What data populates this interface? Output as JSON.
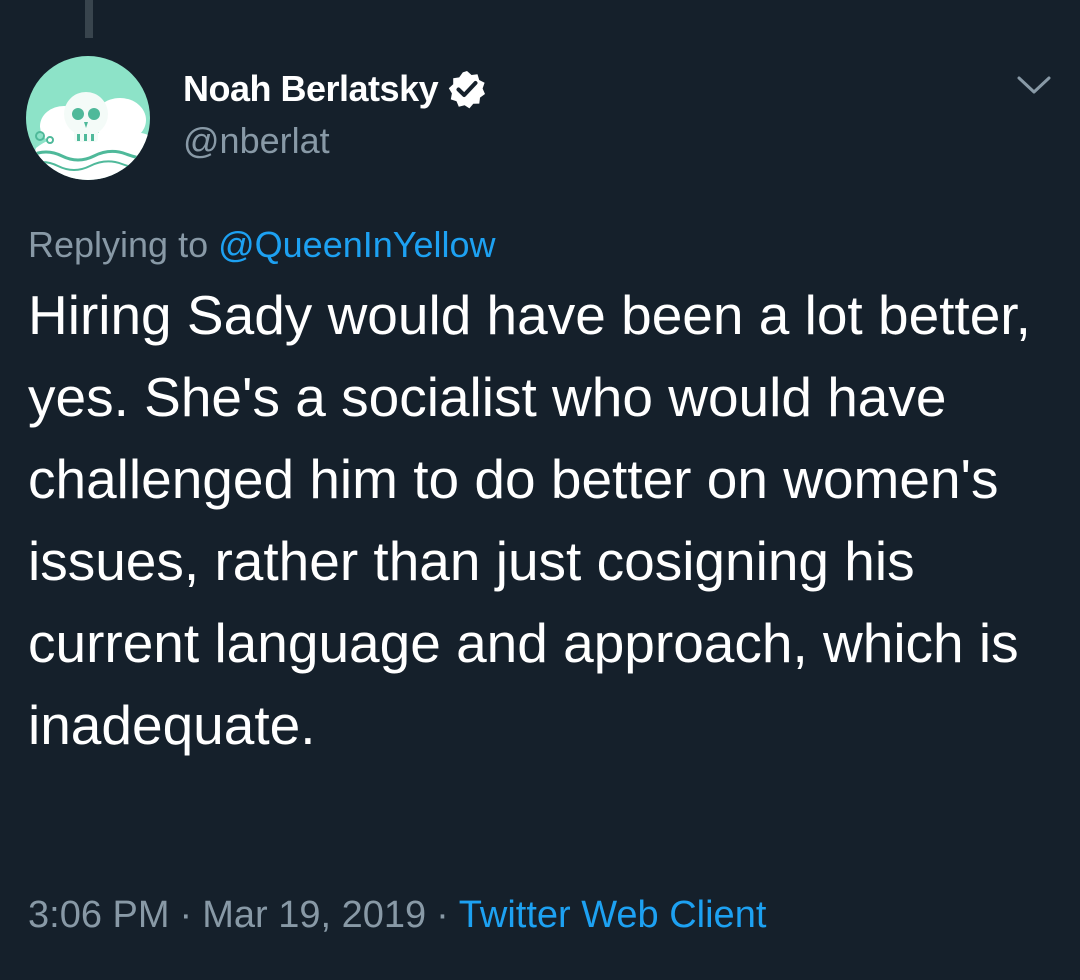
{
  "tweet": {
    "author": {
      "display_name": "Noah Berlatsky",
      "handle": "@nberlat",
      "verified": true,
      "avatar_icon": "skull-avatar",
      "avatar_bg": "#8de3c8"
    },
    "menu_icon": "chevron-down-icon",
    "replying": {
      "prefix": "Replying to ",
      "mention": "@QueenInYellow"
    },
    "text": "Hiring Sady would have been a lot better, yes. She's a socialist who would have challenged him to do better on women's issues, rather than just cosigning his current language and approach, which is inadequate.",
    "time": "3:06 PM",
    "separator": "·",
    "date": "Mar 19, 2019",
    "source": "Twitter Web Client"
  },
  "colors": {
    "background": "#15202b",
    "text": "#ffffff",
    "secondary": "#8899a6",
    "accent": "#1da1f2"
  }
}
